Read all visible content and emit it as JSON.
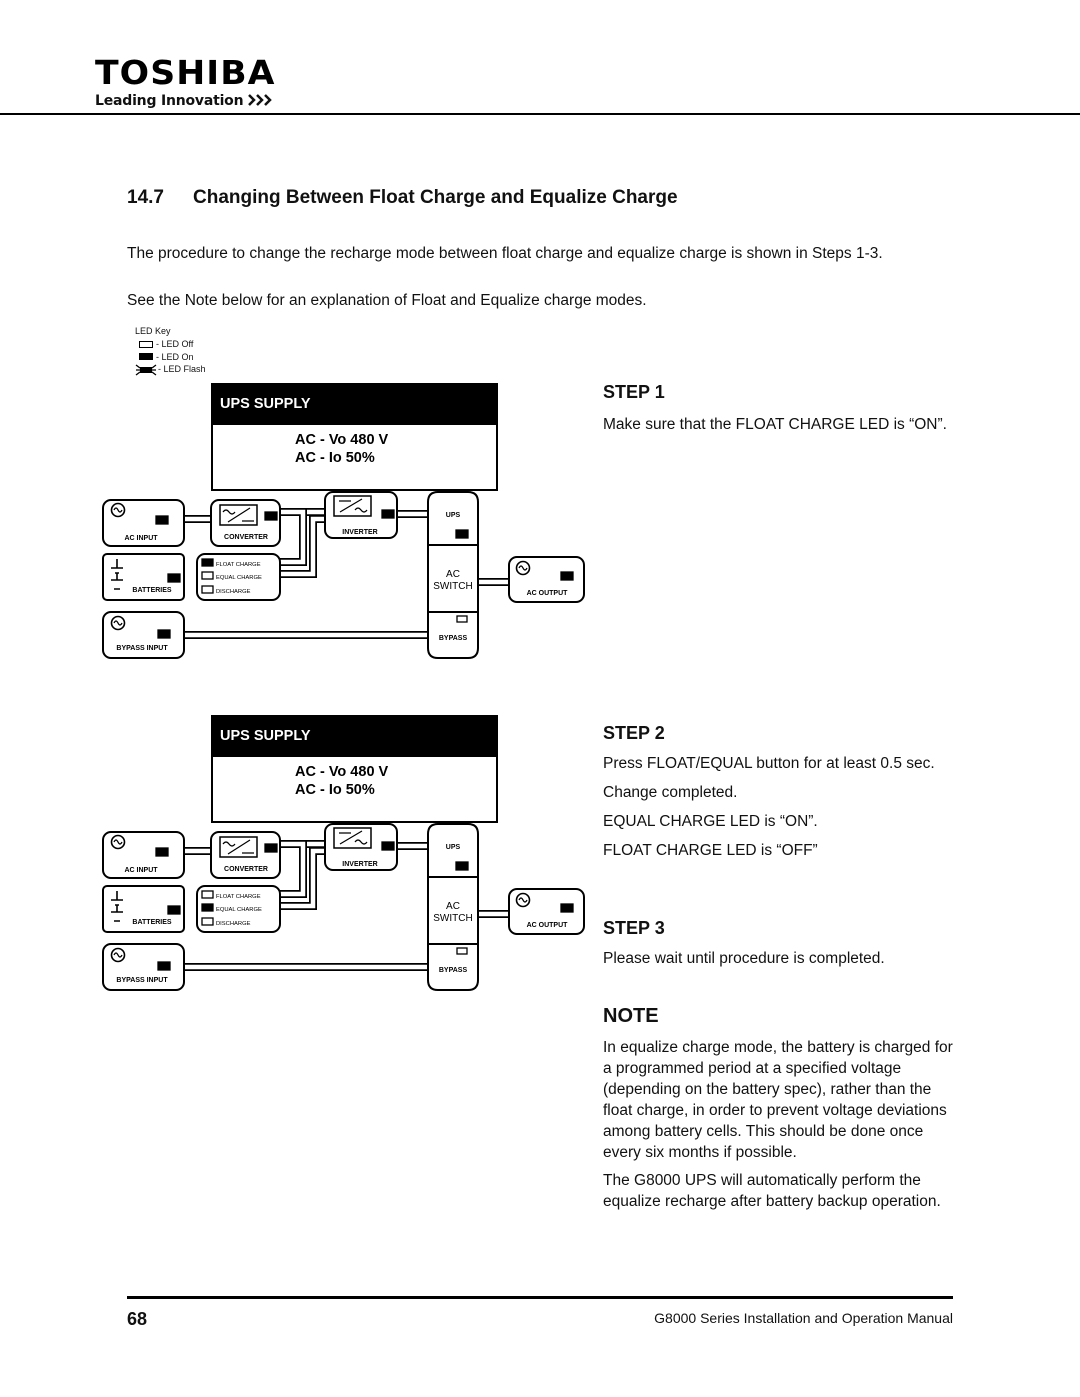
{
  "header": {
    "brand": "TOSHIBA",
    "tagline": "Leading Innovation",
    "tagline_icon": "triple-chevron-right-icon"
  },
  "section": {
    "number": "14.7",
    "title": "Changing Between Float Charge and Equalize Charge",
    "intro": "The procedure to change the recharge mode between float charge and equalize charge is shown in Steps 1-3.",
    "intro2": "See the Note below for an explanation of Float and Equalize charge modes."
  },
  "led_key": {
    "title": "LED Key",
    "items": [
      {
        "state": "off",
        "label": "- LED Off"
      },
      {
        "state": "on",
        "label": "- LED On"
      },
      {
        "state": "flash",
        "label": "- LED Flash"
      }
    ]
  },
  "diagrams": [
    {
      "display_title": "UPS SUPPLY",
      "line1": "AC - Vo  480 V",
      "line2": "AC - Io  50%",
      "labels": {
        "ac_input": "AC INPUT",
        "converter": "CONVERTER",
        "inverter": "INVERTER",
        "ups": "UPS",
        "batteries": "BATTERIES",
        "ac_switch_1": "AC",
        "ac_switch_2": "SWITCH",
        "ac_output": "AC OUTPUT",
        "bypass_input": "BYPASS INPUT",
        "bypass": "BYPASS",
        "float_charge": "FLOAT CHARGE",
        "equal_charge": "EQUAL CHARGE",
        "discharge": "DISCHARGE"
      },
      "leds": {
        "ac_input": "on",
        "converter": "on",
        "inverter": "on",
        "ups": "on",
        "batteries": "on",
        "ac_output": "on",
        "bypass_input": "on",
        "bypass": "off",
        "float_charge": "on",
        "equal_charge": "off",
        "discharge": "off"
      }
    },
    {
      "display_title": "UPS SUPPLY",
      "line1": "AC - Vo  480 V",
      "line2": "AC - Io  50%",
      "labels": {
        "ac_input": "AC INPUT",
        "converter": "CONVERTER",
        "inverter": "INVERTER",
        "ups": "UPS",
        "batteries": "BATTERIES",
        "ac_switch_1": "AC",
        "ac_switch_2": "SWITCH",
        "ac_output": "AC OUTPUT",
        "bypass_input": "BYPASS INPUT",
        "bypass": "BYPASS",
        "float_charge": "FLOAT CHARGE",
        "equal_charge": "EQUAL CHARGE",
        "discharge": "DISCHARGE"
      },
      "leds": {
        "ac_input": "on",
        "converter": "on",
        "inverter": "on",
        "ups": "on",
        "batteries": "on",
        "ac_output": "on",
        "bypass_input": "on",
        "bypass": "off",
        "float_charge": "off",
        "equal_charge": "on",
        "discharge": "off"
      }
    }
  ],
  "steps": [
    {
      "heading": "STEP 1",
      "paragraphs": [
        "Make sure that the FLOAT CHARGE LED is “ON”."
      ]
    },
    {
      "heading": "STEP 2",
      "paragraphs": [
        "Press FLOAT/EQUAL button for at least 0.5 sec.",
        "Change completed.",
        "EQUAL CHARGE LED is “ON”.",
        "FLOAT CHARGE LED is “OFF”"
      ]
    },
    {
      "heading": "STEP 3",
      "paragraphs": [
        "Please wait until procedure is completed."
      ]
    }
  ],
  "note": {
    "heading": "NOTE",
    "paragraphs": [
      "In equalize charge mode, the battery is charged for a programmed period at a specified voltage (depending on the battery spec), rather than the float charge, in order to prevent voltage deviations among battery cells. This should be done once every six months if possible.",
      "The G8000 UPS will automatically perform the equalize recharge after battery backup operation."
    ]
  },
  "footer": {
    "page_number": "68",
    "manual_title": "G8000 Series Installation and Operation Manual"
  }
}
